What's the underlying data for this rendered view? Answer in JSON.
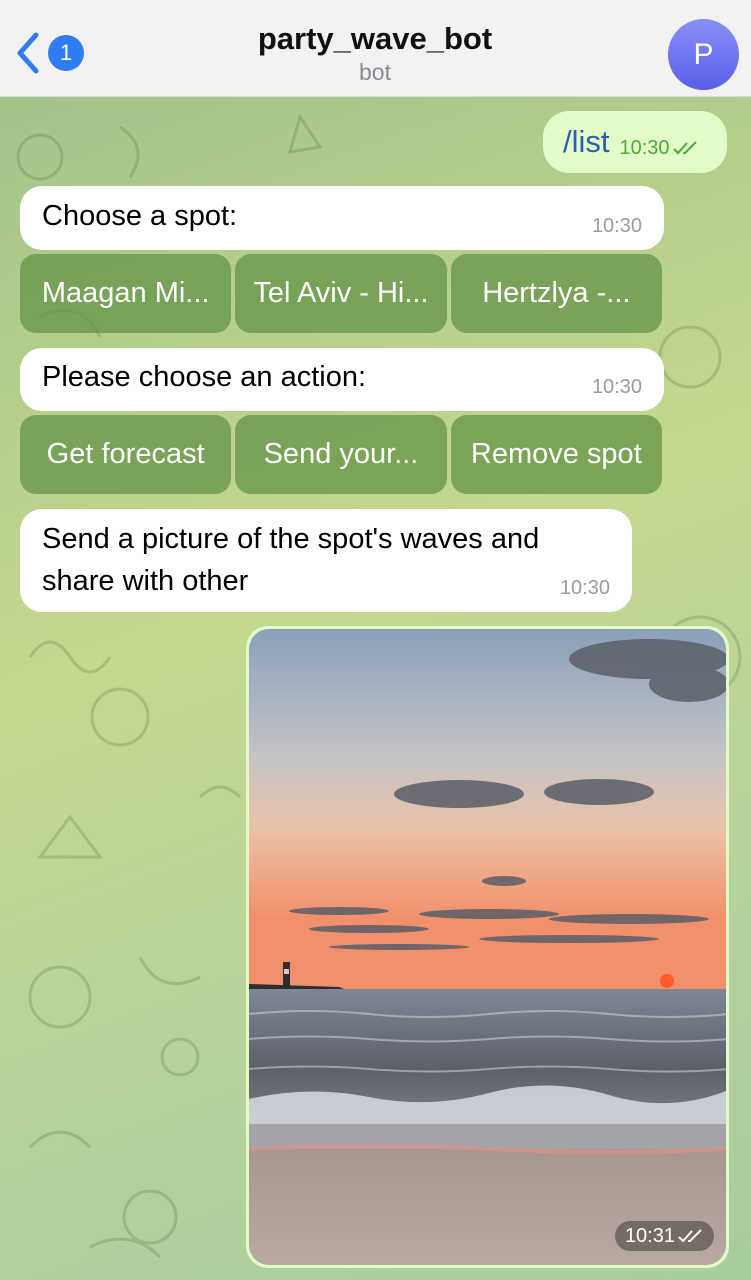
{
  "header": {
    "back_badge": "1",
    "title": "party_wave_bot",
    "subtitle": "bot",
    "avatar_initial": "P"
  },
  "messages": {
    "list_command": {
      "text": "/list",
      "time": "10:30"
    },
    "choose_spot": {
      "text": "Choose a spot:",
      "time": "10:30",
      "buttons": [
        "Maagan Mi...",
        "Tel Aviv - Hi...",
        "Hertzlya -..."
      ]
    },
    "choose_action": {
      "text": "Please choose an action:",
      "time": "10:30",
      "buttons": [
        "Get forecast",
        "Send your...",
        "Remove spot"
      ]
    },
    "send_picture": {
      "line1": "Send a picture of the spot's waves and",
      "line2": "share with other",
      "time": "10:30"
    },
    "photo": {
      "time": "10:31"
    }
  },
  "colors": {
    "accent": "#2f7cf6",
    "outgoing_bubble": "#e2fbc8",
    "keyboard_button": "#68964a",
    "avatar": "#6a6ef0"
  }
}
